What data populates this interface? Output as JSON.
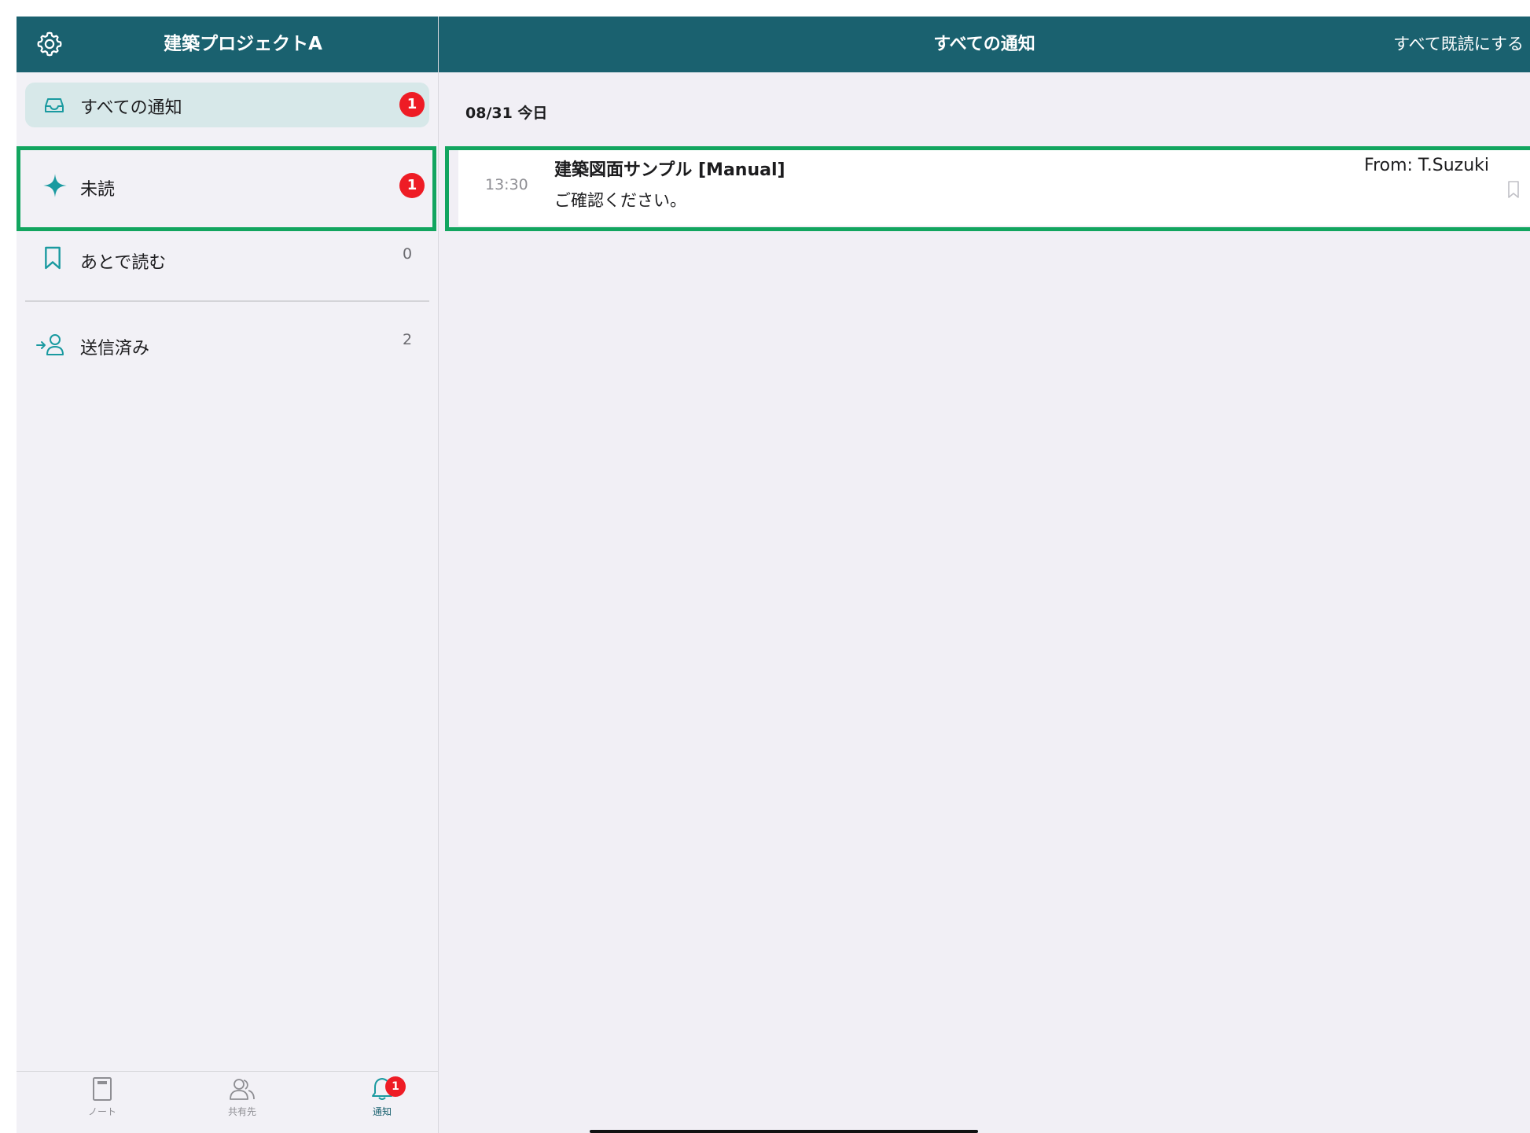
{
  "sidebar": {
    "project_title": "建築プロジェクトA",
    "icons": {
      "settings": "gear-icon"
    },
    "items": [
      {
        "label": "すべての通知",
        "icon": "inbox-icon",
        "badge": "1"
      },
      {
        "label": "未読",
        "icon": "sparkle-icon",
        "badge": "1"
      },
      {
        "label": "あとで読む",
        "icon": "bookmark-icon",
        "count": "0"
      },
      {
        "label": "送信済み",
        "icon": "send-user-icon",
        "count": "2"
      }
    ]
  },
  "tabbar": {
    "tabs": [
      {
        "label": "ノート",
        "icon": "note-icon"
      },
      {
        "label": "共有先",
        "icon": "people-icon"
      },
      {
        "label": "通知",
        "icon": "bell-icon",
        "badge": "1"
      }
    ]
  },
  "main": {
    "title": "すべての通知",
    "mark_all_read": "すべて既読にする",
    "date_group": "08/31 今日",
    "notifications": [
      {
        "time": "13:30",
        "title": "建築図面サンプル [Manual]",
        "body": "ご確認ください。",
        "from": "From: T.Suzuki"
      }
    ]
  },
  "colors": {
    "header": "#1a616f",
    "accent": "#1a9aa0",
    "badge": "#ee1c25",
    "highlight": "#12a55f",
    "background": "#f1eff5"
  }
}
